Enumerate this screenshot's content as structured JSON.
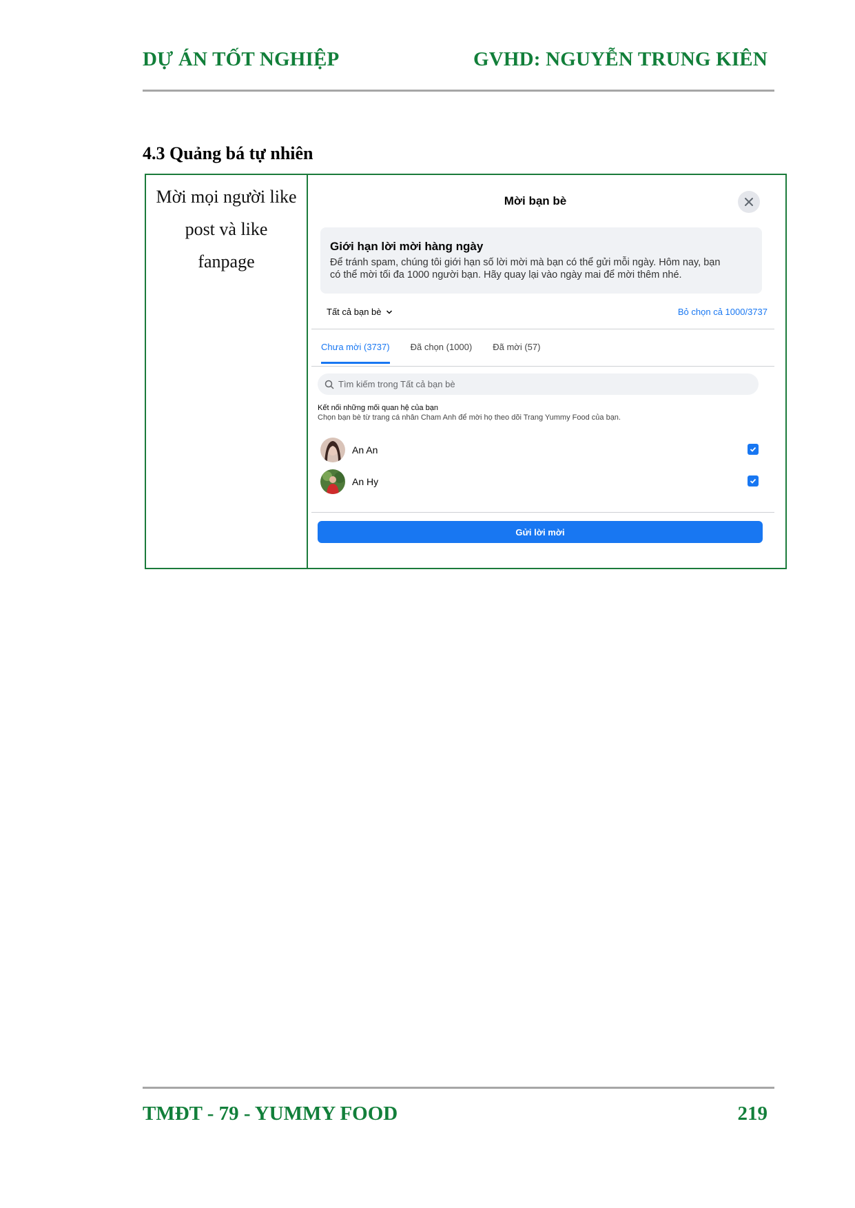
{
  "header": {
    "left": "DỰ ÁN TỐT NGHIỆP",
    "right": "GVHD: NGUYỄN TRUNG KIÊN"
  },
  "section_title": "4.3 Quảng bá tự nhiên",
  "table": {
    "description_lines": [
      "Mời mọi người like",
      "post và like",
      "fanpage"
    ]
  },
  "dialog": {
    "title": "Mời bạn bè",
    "close_icon": "close-icon",
    "notice_title": "Giới hạn lời mời hàng ngày",
    "notice_text_1": "Để tránh spam, chúng tôi giới hạn số lời mời mà bạn có thể gửi mỗi ngày. Hôm nay, bạn",
    "notice_text_2": "có thể mời tối đa 1000 người bạn. Hãy quay lại vào ngày mai để mời thêm nhé.",
    "filter_label": "Tất cả bạn bè",
    "deselect_label": "Bỏ chọn cả 1000/3737",
    "tabs": [
      {
        "label": "Chưa mời (3737)",
        "active": true
      },
      {
        "label": "Đã chọn (1000)",
        "active": false
      },
      {
        "label": "Đã mời (57)",
        "active": false
      }
    ],
    "search_placeholder": "Tìm kiếm trong Tất cả bạn bè",
    "connect_title": "Kết nối những mối quan hệ của bạn",
    "connect_sub": "Chọn bạn bè từ trang cá nhân Cham Anh để mời họ theo dõi Trang Yummy Food của bạn.",
    "friends": [
      {
        "name": "An An",
        "checked": true
      },
      {
        "name": "An Hy",
        "checked": true
      }
    ],
    "send_button": "Gửi lời mời",
    "accent_color": "#1877f2"
  },
  "footer": {
    "left": "TMĐT - 79 - YUMMY FOOD",
    "page_number": "219"
  }
}
